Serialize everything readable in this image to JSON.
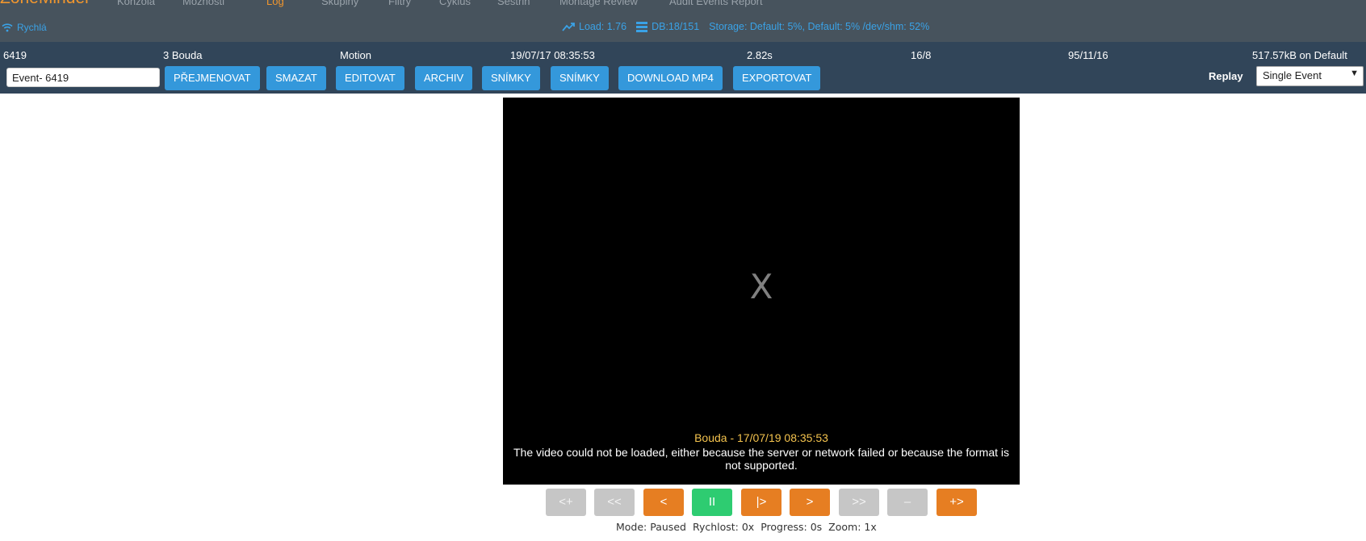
{
  "navbar": {
    "brand": "ZoneMinder",
    "items": [
      {
        "label": "Konzola"
      },
      {
        "label": "Možnosti"
      },
      {
        "label": "Log"
      },
      {
        "label": "Skupiny"
      },
      {
        "label": "Filtry"
      },
      {
        "label": "Cyklus"
      },
      {
        "label": "Sestřih"
      },
      {
        "label": "Montage Review"
      },
      {
        "label": "Audit Events Report"
      }
    ],
    "bandwidth": "Rychlá",
    "load": "Load: 1.76",
    "db": "DB:18/151",
    "storage": "Storage: Default: 5%, Default: 5% /dev/shm: 52%",
    "brand_color": "#f0962e",
    "accent_color": "#3aa2e6"
  },
  "event": {
    "id": "6419",
    "monitor": "3 Bouda",
    "cause": "Motion",
    "datetime": "19/07/17 08:35:53",
    "duration": "2.82s",
    "frames": "16/8",
    "scores": "95/11/16",
    "disk": "517.57kB on Default",
    "name_value": "Event- 6419"
  },
  "actions": {
    "rename": "PŘEJMENOVAT",
    "delete": "SMAZAT",
    "edit": "EDITOVAT",
    "archive": "ARCHIV",
    "frames": "SNÍMKY",
    "stills": "SNÍMKY",
    "download": "DOWNLOAD MP4",
    "export": "EXPORTOVAT"
  },
  "replay": {
    "label": "Replay",
    "selected": "Single Event"
  },
  "video": {
    "error_glyph": "X",
    "caption": "Bouda - 17/07/19 08:35:53",
    "error_line1": "The video could not be loaded, either because the server or network failed or because the format is",
    "error_line2": "not supported."
  },
  "controls": {
    "fast_rev": "<+",
    "prev_event": "<<",
    "step_back": "<",
    "pause": "II",
    "play": "|>",
    "step_fwd": ">",
    "next_event": ">>",
    "zoom_out": "–",
    "fast_fwd": "+>"
  },
  "status": {
    "mode": "Mode: Paused",
    "rate": "Rychlost: 0x",
    "progress": "Progress: 0s",
    "zoom": "Zoom: 1x"
  }
}
